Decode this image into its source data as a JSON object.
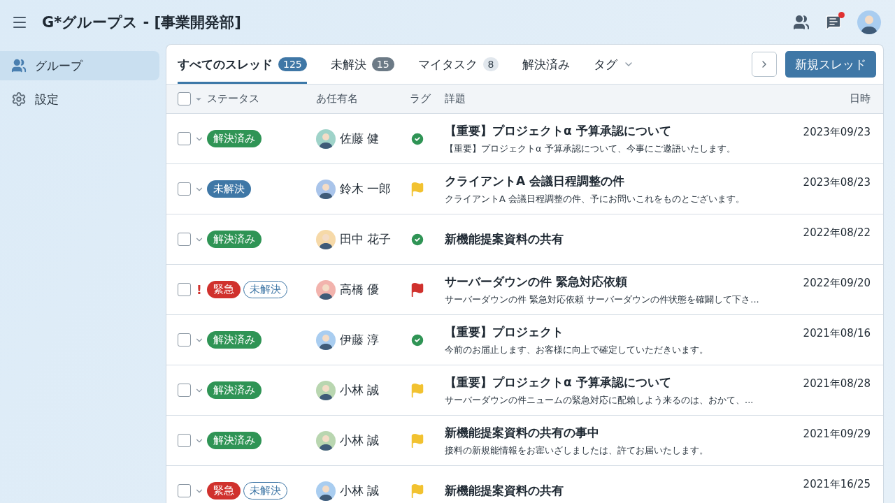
{
  "app_bar": {
    "title": "G*グループス - [事業開発部]",
    "notification": true
  },
  "sidebar": {
    "items": [
      {
        "label": "グループ",
        "selected": true
      },
      {
        "label": "設定",
        "selected": false
      }
    ]
  },
  "tabs": [
    {
      "label": "すべてのスレッド",
      "count": "125",
      "selected": true
    },
    {
      "label": "未解決",
      "count": "15",
      "selected": false
    },
    {
      "label": "マイタスク",
      "count": "8",
      "selected": false
    },
    {
      "label": "解決済み",
      "selected": false
    },
    {
      "label": "タグ",
      "dropdown": true,
      "selected": false
    }
  ],
  "new_thread_button": "新規スレッド",
  "table": {
    "select_all_checked": false,
    "columns": [
      "ステータス",
      "あ任有名",
      "ラグ",
      "詳題",
      "日時"
    ],
    "rows": [
      {
        "checked": false,
        "badges": [
          {
            "label": "解決済み",
            "kind": "resolved"
          }
        ],
        "assignee": "佐藤 健",
        "color": "#9fd3c9",
        "kind": "check",
        "title": "【重要】プロジェクトα 予算承認について",
        "snippet": "【重要】プロジェクトα 予算承認について、今事にご遨語いたします。",
        "date": "2023年09/23"
      },
      {
        "checked": false,
        "badges": [
          {
            "label": "未解決",
            "kind": "open"
          }
        ],
        "assignee": "鈴木 一郎",
        "color": "#a9c4ea",
        "kind": "flag",
        "title": "クライアントA 会議日程調整の件",
        "snippet": "クライアントA 会議日程調整の件、予にお問いこれをものとございます。",
        "date": "2023年08/23"
      },
      {
        "checked": false,
        "badges": [
          {
            "label": "解決済み",
            "kind": "resolved"
          }
        ],
        "assignee": "田中 花子",
        "color": "#f6d9a8",
        "kind": "check",
        "title": "新機能提案資料の共有",
        "date": "2022年08/22"
      },
      {
        "checked": false,
        "alert": "!",
        "badges": [
          {
            "label": "緊急",
            "kind": "urgent"
          },
          {
            "label": "未解決",
            "kind": "open-outline"
          }
        ],
        "assignee": "高橋 優",
        "color": "#f2b3ad",
        "kind": "red-flag",
        "title": "サーバーダウンの件 緊急対応依頼",
        "snippet": "サーバーダウンの件 緊急対応依頼  サーバーダウンの件状態を確闢して下さ...",
        "date": "2022年09/20"
      },
      {
        "checked": false,
        "badges": [
          {
            "label": "解決済み",
            "kind": "resolved"
          }
        ],
        "assignee": "伊藤 淳",
        "color": "#a9cdf0",
        "kind": "check",
        "title": "【重要】プロジェクト",
        "snippet": "今前のお届止します、お客様に向上で確定していただきいます。",
        "date": "2021年08/16"
      },
      {
        "checked": false,
        "badges": [
          {
            "label": "解決済み",
            "kind": "resolved"
          }
        ],
        "assignee": "小林 誠",
        "color": "#b9d6b0",
        "kind": "flag",
        "title": "【重要】プロジェクトα 予算承認について",
        "snippet": "サーバーダウンの件ニュームの緊急対応に配賴しよう来るのは、おかて、...",
        "date": "2021年08/28"
      },
      {
        "checked": false,
        "badges": [
          {
            "label": "解決済み",
            "kind": "resolved"
          }
        ],
        "assignee": "小林 誠",
        "color": "#b9d6b0",
        "kind": "flag",
        "title": "新機能提案資料の共有の事中",
        "snippet": "接料の新規能情報をお寚いざしましたは、許てお届いたします。",
        "date": "2021年09/29"
      },
      {
        "checked": false,
        "badges": [
          {
            "label": "緊急",
            "kind": "urgent"
          },
          {
            "label": "未解決",
            "kind": "open-outline"
          }
        ],
        "assignee": "小林 誠",
        "color": "#a9cdf0",
        "kind": "flag",
        "title": "新機能提案資料の共有",
        "date": "2021年16/25"
      }
    ]
  }
}
